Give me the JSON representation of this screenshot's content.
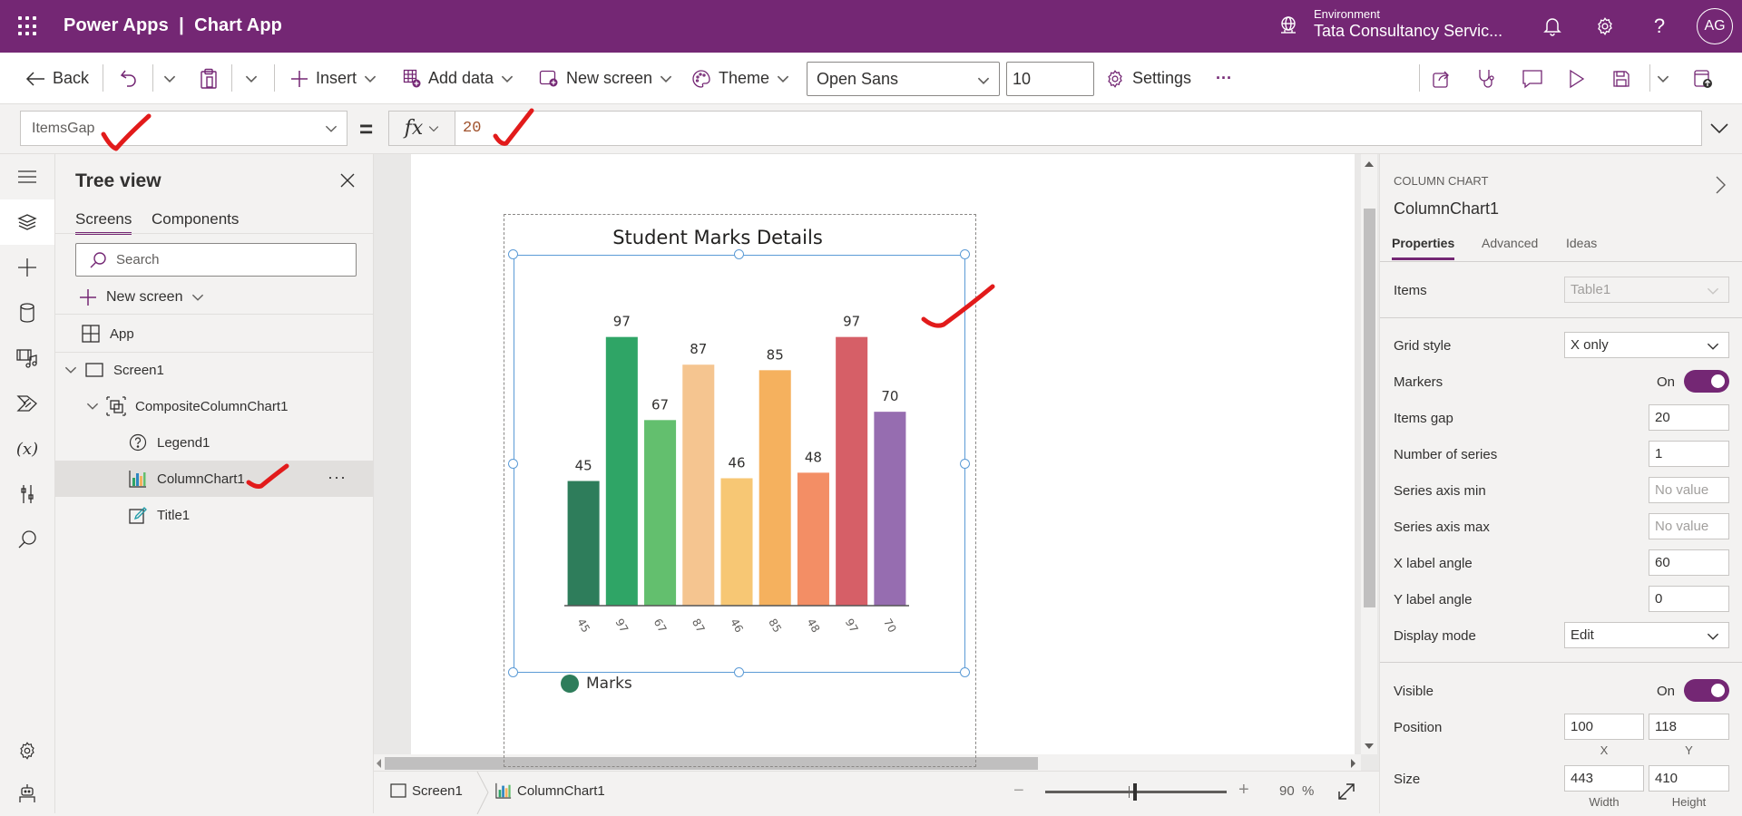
{
  "header": {
    "app_title": "Power Apps  |  Chart App",
    "environment_label": "Environment",
    "environment_name": "Tata Consultancy Servic...",
    "avatar_initials": "AG",
    "brand_color": "#742774"
  },
  "toolbar": {
    "back": "Back",
    "insert": "Insert",
    "add_data": "Add data",
    "new_screen": "New screen",
    "theme": "Theme",
    "font_family": "Open Sans",
    "font_size": "10",
    "settings": "Settings",
    "more": "···"
  },
  "formula_bar": {
    "property": "ItemsGap",
    "equals": "=",
    "fx": "fx",
    "formula": "20"
  },
  "tree_view": {
    "title": "Tree view",
    "tabs": [
      "Screens",
      "Components"
    ],
    "active_tab": "Screens",
    "search_placeholder": "Search",
    "new_screen": "New screen",
    "items": [
      {
        "label": "App",
        "icon": "app-icon",
        "level": 0
      },
      {
        "label": "Screen1",
        "icon": "screen-icon",
        "level": 0,
        "expanded": true
      },
      {
        "label": "CompositeColumnChart1",
        "icon": "group-icon",
        "level": 1,
        "expanded": true
      },
      {
        "label": "Legend1",
        "icon": "legend-icon",
        "level": 2
      },
      {
        "label": "ColumnChart1",
        "icon": "column-chart-icon",
        "level": 2,
        "selected": true
      },
      {
        "label": "Title1",
        "icon": "label-edit-icon",
        "level": 2
      }
    ]
  },
  "chart_data": {
    "type": "bar",
    "title": "Student Marks Details",
    "categories": [
      "45",
      "97",
      "67",
      "87",
      "46",
      "85",
      "48",
      "97",
      "70"
    ],
    "values": [
      45,
      97,
      67,
      87,
      46,
      85,
      48,
      97,
      70
    ],
    "series": [
      {
        "name": "Marks",
        "values": [
          45,
          97,
          67,
          87,
          46,
          85,
          48,
          97,
          70
        ]
      }
    ],
    "colors": [
      "#2e7d5b",
      "#2fa566",
      "#63bf6e",
      "#f5c590",
      "#f7c774",
      "#f5b15e",
      "#f38e65",
      "#d65f67",
      "#966db0"
    ],
    "legend": [
      "Marks"
    ],
    "legend_color": "#2e7d5b",
    "data_labels": true,
    "xlabel": "",
    "ylabel": "",
    "x_label_angle": 60,
    "ylim": [
      0,
      100
    ],
    "grid": "x only",
    "legend_position": "bottom-left"
  },
  "status_bar": {
    "breadcrumb": [
      "Screen1",
      "ColumnChart1"
    ],
    "zoom_minus": "−",
    "zoom_plus": "+",
    "zoom_value": "90",
    "zoom_unit": "%",
    "zoom_percent": 90
  },
  "properties_panel": {
    "control_type": "COLUMN CHART",
    "control_name": "ColumnChart1",
    "tabs": [
      "Properties",
      "Advanced",
      "Ideas"
    ],
    "active_tab": "Properties",
    "items_label": "Items",
    "items_value": "Table1",
    "grid_style_label": "Grid style",
    "grid_style_value": "X only",
    "markers_label": "Markers",
    "markers_state": "On",
    "items_gap_label": "Items gap",
    "items_gap_value": "20",
    "number_of_series_label": "Number of series",
    "number_of_series_value": "1",
    "series_axis_min_label": "Series axis min",
    "series_axis_min_placeholder": "No value",
    "series_axis_max_label": "Series axis max",
    "series_axis_max_placeholder": "No value",
    "x_label_angle_label": "X label angle",
    "x_label_angle_value": "60",
    "y_label_angle_label": "Y label angle",
    "y_label_angle_value": "0",
    "display_mode_label": "Display mode",
    "display_mode_value": "Edit",
    "visible_label": "Visible",
    "visible_state": "On",
    "position_label": "Position",
    "position_x": "100",
    "position_y": "118",
    "position_x_caption": "X",
    "position_y_caption": "Y",
    "size_label": "Size",
    "size_width": "443",
    "size_height": "410",
    "size_width_caption": "Width",
    "size_height_caption": "Height"
  }
}
